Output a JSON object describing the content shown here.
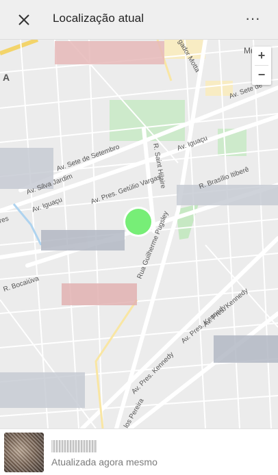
{
  "header": {
    "title": "Localização atual",
    "close_icon": "close-icon",
    "more_icon": "more-horizontal-icon",
    "more_glyph": "···"
  },
  "map": {
    "streets": [
      "Av. Sete de Setembro",
      "Av. Sete de",
      "Av. Iguaçu",
      "Av. Iguaçu",
      "R. Brasílio Itiberê",
      "Av. Pres. Getúlio Vargas",
      "Av. Silva Jardim",
      "R. Saint Hilaire",
      "Rua Guilherme Pugsley",
      "Av. Pres. Kennedy",
      "Av. Pres. Kennedy",
      "Av. Pres. Kennedy",
      "R. Bocaiúva",
      "gador Motta",
      "Mu",
      "A",
      "res",
      "los Pereira"
    ],
    "location_marker_color": "#77ee77",
    "accent_color": "#1a8ac7"
  },
  "zoom": {
    "in_label": "+",
    "out_label": "−"
  },
  "footer": {
    "subtitle": "Atualizada agora mesmo"
  }
}
